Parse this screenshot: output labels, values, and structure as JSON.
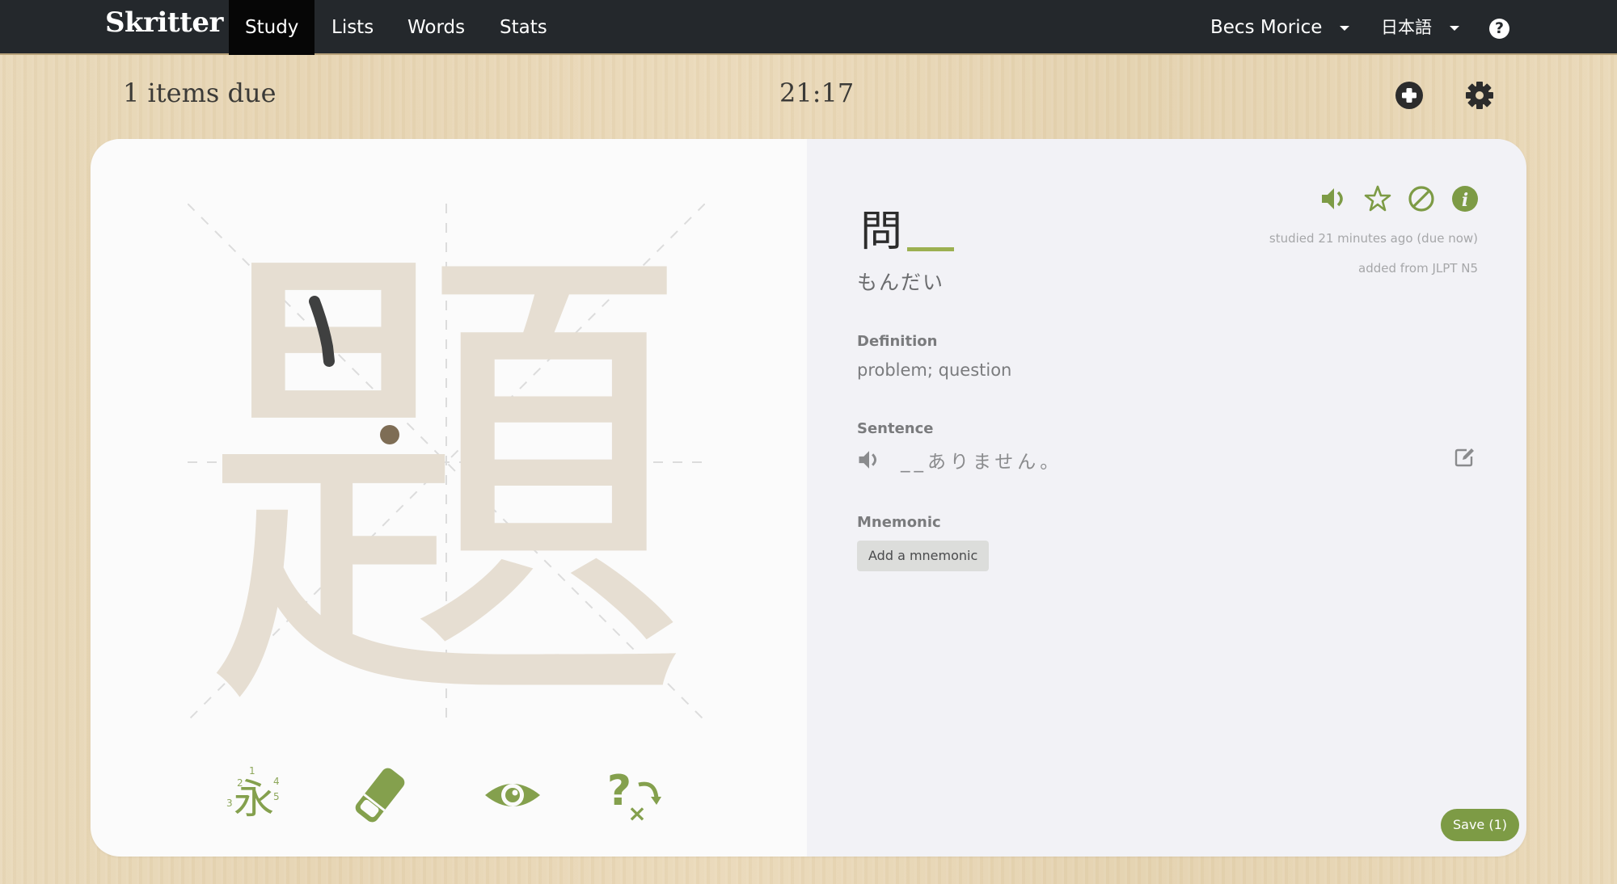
{
  "navbar": {
    "brand": "Skritter",
    "items": [
      {
        "label": "Study",
        "active": true
      },
      {
        "label": "Lists",
        "active": false
      },
      {
        "label": "Words",
        "active": false
      },
      {
        "label": "Stats",
        "active": false
      }
    ],
    "user_menu": "Becs Morice",
    "language_menu": "日本語",
    "help_icon": "question-circle-icon"
  },
  "study_header": {
    "items_due": "1 items due",
    "timer": "21:17",
    "add_icon": "plus-circle-icon",
    "settings_icon": "gear-icon"
  },
  "canvas": {
    "character": "題",
    "strokes_completed": 1,
    "tools": [
      {
        "name": "stroke-order-icon",
        "label": "永",
        "numbers": [
          "1",
          "2",
          "3",
          "4",
          "5"
        ]
      },
      {
        "name": "eraser-icon"
      },
      {
        "name": "reveal-eye-icon"
      },
      {
        "name": "mark-wrong-icon",
        "glyphs": [
          "?",
          "×"
        ]
      }
    ]
  },
  "card": {
    "word_prefix": "問",
    "reading": "もんだい",
    "actions": [
      "speaker-icon",
      "star-icon",
      "ban-icon",
      "info-icon"
    ],
    "studied": "studied 21 minutes ago (due now)",
    "source": "added from JLPT N5",
    "definition_label": "Definition",
    "definition": "problem; question",
    "sentence_label": "Sentence",
    "sentence": "__ありません。",
    "mnemonic_label": "Mnemonic",
    "mnemonic_button": "Add a mnemonic",
    "save_button": "Save (1)"
  },
  "colors": {
    "accent_green": "#7d9b45",
    "navbar_bg": "#24282c",
    "ghost_stroke": "#e6ded2",
    "drawn_stroke": "#3f4040"
  }
}
